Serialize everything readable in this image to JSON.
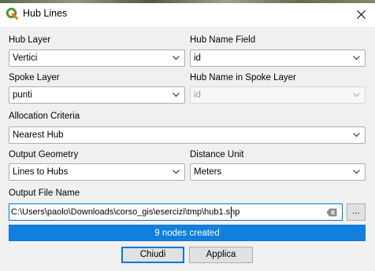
{
  "window": {
    "title": "Hub Lines",
    "close_icon": "close-icon",
    "app_icon": "qgis-logo-icon"
  },
  "form": {
    "hub_layer": {
      "label": "Hub Layer",
      "value": "Vertici"
    },
    "hub_name_field": {
      "label": "Hub Name Field",
      "value": "id"
    },
    "spoke_layer": {
      "label": "Spoke Layer",
      "value": "punti"
    },
    "hub_name_spoke": {
      "label": "Hub Name in Spoke Layer",
      "value": "id",
      "disabled": true
    },
    "allocation": {
      "label": "Allocation Criteria",
      "value": "Nearest Hub"
    },
    "output_geometry": {
      "label": "Output Geometry",
      "value": "Lines to Hubs"
    },
    "distance_unit": {
      "label": "Distance Unit",
      "value": "Meters"
    },
    "output_file": {
      "label": "Output File Name",
      "value": "C:\\Users\\paolo\\Downloads\\corso_gis\\esercizi\\tmp\\hub1.shp",
      "browse_label": "..."
    }
  },
  "progress": {
    "text": "9 nodes created",
    "fraction": 1.0
  },
  "buttons": {
    "close_label": "Chiudi",
    "apply_label": "Applica"
  },
  "colors": {
    "accent": "#0078d7",
    "progress_fill": "#0f7fe0",
    "qgis_green": "#589632"
  }
}
